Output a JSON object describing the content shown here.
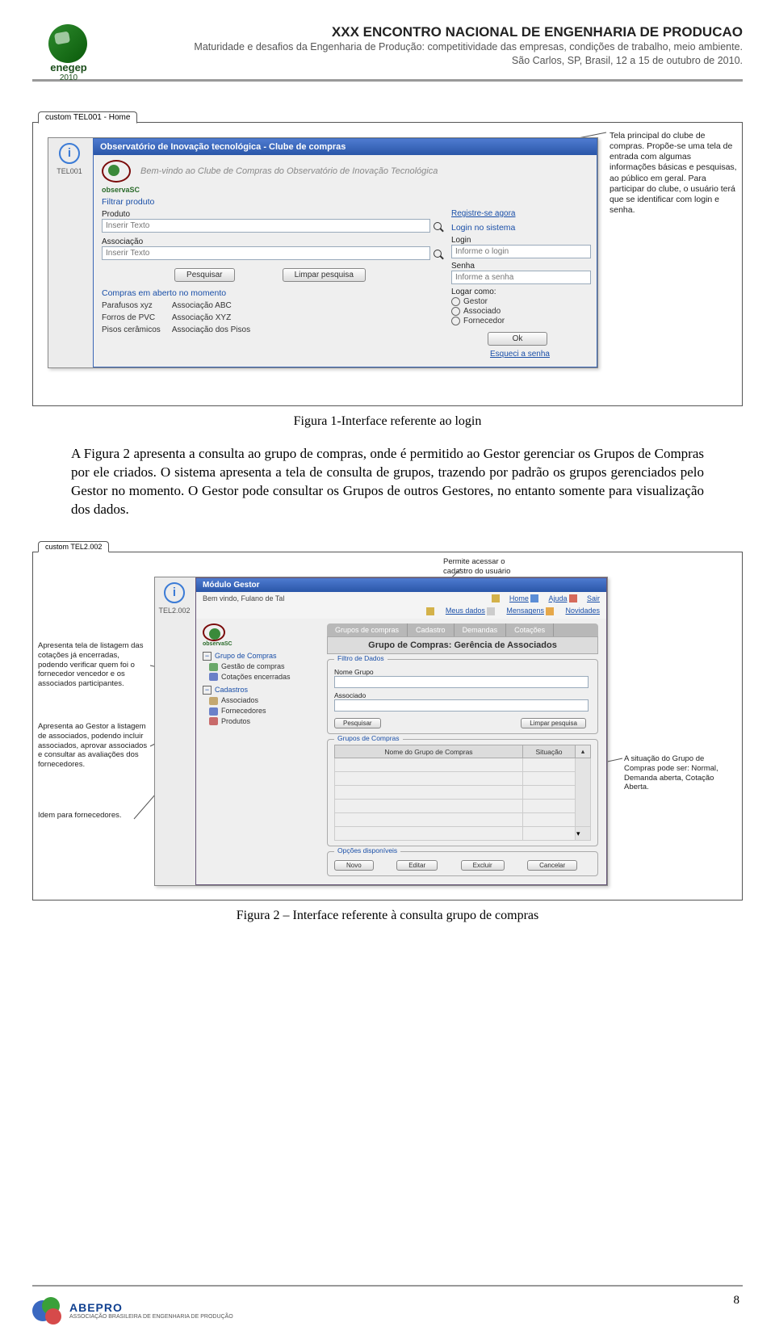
{
  "header": {
    "logo_label": "enegep",
    "logo_year": "2010",
    "title": "XXX ENCONTRO NACIONAL DE ENGENHARIA DE PRODUCAO",
    "subtitle": "Maturidade e desafios da Engenharia de Produção: competitividade das empresas, condições de trabalho, meio ambiente.",
    "location": "São Carlos, SP, Brasil, 12 a 15 de outubro de 2010."
  },
  "figure1": {
    "caption": "Figura 1-Interface referente ao login",
    "tab": "custom TEL001 - Home",
    "annotation": "Tela principal do clube de compras. Propõe-se uma tela de entrada com algumas informações básicas e pesquisas, ao público em geral. Para participar do clube, o usuário terá que se identificar com login e senha.",
    "sidebar_label": "TEL001",
    "window_title": "Observatório de Inovação tecnológica - Clube de compras",
    "welcome": "Bem-vindo ao Clube de Compras do Observatório de Inovação Tecnológica",
    "observa": "observaSC",
    "filter_title": "Filtrar produto",
    "product_label": "Produto",
    "product_placeholder": "Inserir Texto",
    "assoc_label": "Associação",
    "assoc_placeholder": "Inserir Texto",
    "btn_search": "Pesquisar",
    "btn_clear": "Limpar pesquisa",
    "open_title": "Compras em aberto no momento",
    "open_rows": [
      [
        "Parafusos xyz",
        "Associação ABC"
      ],
      [
        "Forros de PVC",
        "Associação XYZ"
      ],
      [
        "Pisos cerâmicos",
        "Associação dos Pisos"
      ]
    ],
    "register_link": "Registre-se agora",
    "login_title": "Login no sistema",
    "login_label": "Login",
    "login_placeholder": "Informe o login",
    "senha_label": "Senha",
    "senha_placeholder": "Informe a senha",
    "logar_como": "Logar como:",
    "roles": [
      "Gestor",
      "Associado",
      "Fornecedor"
    ],
    "btn_ok": "Ok",
    "forgot": "Esqueci a senha"
  },
  "paragraph": "A Figura 2 apresenta a consulta ao grupo de compras, onde é permitido ao Gestor gerenciar os Grupos de Compras por ele criados. O sistema apresenta a tela de consulta de grupos, trazendo por padrão os grupos gerenciados pelo Gestor no momento. O Gestor pode consultar os Grupos de outros Gestores, no entanto somente para visualização dos dados.",
  "figure2": {
    "caption": "Figura 2 – Interface referente à consulta grupo de compras",
    "tab": "custom TEL2.002",
    "annotation_top": "Permite acessar o cadastro do usuário logado",
    "annotation_left1": "Apresenta tela de listagem das cotações já encerradas, podendo verificar quem foi o fornecedor vencedor e os associados participantes.",
    "annotation_left2": "Apresenta ao Gestor a listagem de associados, podendo incluir associados, aprovar associados e consultar as avaliações dos fornecedores.",
    "annotation_left3": "Idem para fornecedores.",
    "annotation_right": "A situação do Grupo de Compras pode ser: Normal, Demanda aberta, Cotação Aberta.",
    "sidebar_label": "TEL2.002",
    "window_title": "Módulo Gestor",
    "welcome_user": "Bem vindo, Fulano de Tal",
    "top_links": [
      "Home",
      "Ajuda",
      "Sair"
    ],
    "link_row": [
      "Meus dados",
      "Mensagens",
      "Novidades"
    ],
    "observa": "observaSC",
    "tree_grupo_head": "Grupo de Compras",
    "tree_grupo_items": [
      "Gestão de compras",
      "Cotações encerradas"
    ],
    "tree_cad_head": "Cadastros",
    "tree_cad_items": [
      "Associados",
      "Fornecedores",
      "Produtos"
    ],
    "tabs": [
      "Grupos de compras",
      "Cadastro",
      "Demandas",
      "Cotações"
    ],
    "banner": "Grupo de Compras: Gerência de Associados",
    "filter_legend": "Filtro de Dados",
    "filter_nome": "Nome Grupo",
    "filter_assoc": "Associado",
    "btn_search": "Pesquisar",
    "btn_clear": "Limpar pesquisa",
    "gc_legend": "Grupos de Compras",
    "col1": "Nome do Grupo de Compras",
    "col2": "Situação",
    "opts_legend": "Opções disponíveis",
    "opt_buttons": [
      "Novo",
      "Editar",
      "Excluir",
      "Cancelar"
    ]
  },
  "footer": {
    "logo": "ABEPRO",
    "logo_sub": "ASSOCIAÇÃO BRASILEIRA DE ENGENHARIA DE PRODUÇÃO",
    "pagenum": "8"
  }
}
